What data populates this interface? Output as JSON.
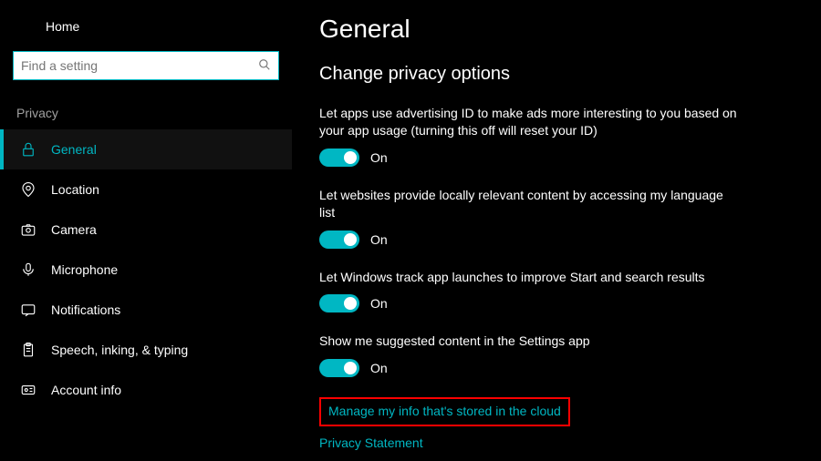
{
  "home_label": "Home",
  "search": {
    "placeholder": "Find a setting"
  },
  "section_label": "Privacy",
  "nav": [
    {
      "label": "General",
      "active": true,
      "icon": "lock-icon"
    },
    {
      "label": "Location",
      "active": false,
      "icon": "location-icon"
    },
    {
      "label": "Camera",
      "active": false,
      "icon": "camera-icon"
    },
    {
      "label": "Microphone",
      "active": false,
      "icon": "microphone-icon"
    },
    {
      "label": "Notifications",
      "active": false,
      "icon": "notifications-icon"
    },
    {
      "label": "Speech, inking, & typing",
      "active": false,
      "icon": "clipboard-icon"
    },
    {
      "label": "Account info",
      "active": false,
      "icon": "account-icon"
    }
  ],
  "page_title": "General",
  "subheading": "Change privacy options",
  "options": [
    {
      "desc": "Let apps use advertising ID to make ads more interesting to you based on your app usage (turning this off will reset your ID)",
      "state": "On"
    },
    {
      "desc": "Let websites provide locally relevant content by accessing my language list",
      "state": "On"
    },
    {
      "desc": "Let Windows track app launches to improve Start and search results",
      "state": "On"
    },
    {
      "desc": "Show me suggested content in the Settings app",
      "state": "On"
    }
  ],
  "links": {
    "cloud": "Manage my info that's stored in the cloud",
    "privacy": "Privacy Statement"
  }
}
